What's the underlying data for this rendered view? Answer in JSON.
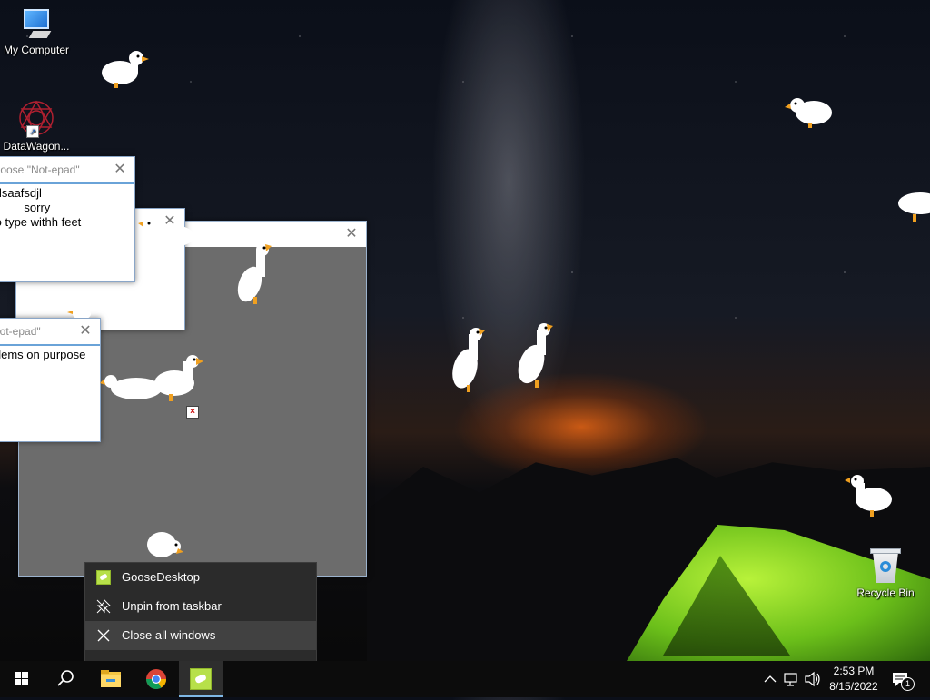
{
  "desktop": {
    "icons": [
      {
        "label": "My Computer"
      },
      {
        "label": "DataWagon..."
      },
      {
        "label": "Recycle Bin"
      }
    ]
  },
  "windows": [
    {
      "title": "Goose \"Not-epad\"",
      "close": "✕",
      "lines": [
        "fdsaafsdjl",
        "s        sorry",
        "to type withh feet"
      ]
    },
    {
      "title": "",
      "close": "✕",
      "lines": []
    },
    {
      "title": "",
      "close": "✕",
      "lines": []
    },
    {
      "title": "Not-epad\"",
      "close": "✕",
      "lines": [
        "blems on purpose"
      ]
    }
  ],
  "error_mark": "×",
  "context_menu": {
    "items": [
      {
        "label": "GooseDesktop",
        "icon": "goose-app-icon"
      },
      {
        "label": "Unpin from taskbar",
        "icon": "unpin-icon"
      },
      {
        "label": "Close all windows",
        "icon": "close-icon",
        "highlighted": true
      }
    ]
  },
  "taskbar": {
    "buttons": [
      {
        "name": "start",
        "icon": "windows-logo-icon"
      },
      {
        "name": "search",
        "icon": "search-icon"
      },
      {
        "name": "file-explorer",
        "icon": "folder-icon"
      },
      {
        "name": "chrome",
        "icon": "chrome-icon"
      },
      {
        "name": "goose-desktop",
        "icon": "goose-app-icon",
        "active": true
      }
    ],
    "tray": {
      "time": "2:53 PM",
      "date": "8/15/2022",
      "notification_count": "1"
    }
  },
  "colors": {
    "taskbar_bg": "#0c0c0c",
    "menu_bg": "#2b2b2b",
    "menu_highlight": "#414141",
    "active_underline": "#7fb8e6",
    "window_border": "#8aa6c8",
    "tent_green": "#8ede2a"
  }
}
